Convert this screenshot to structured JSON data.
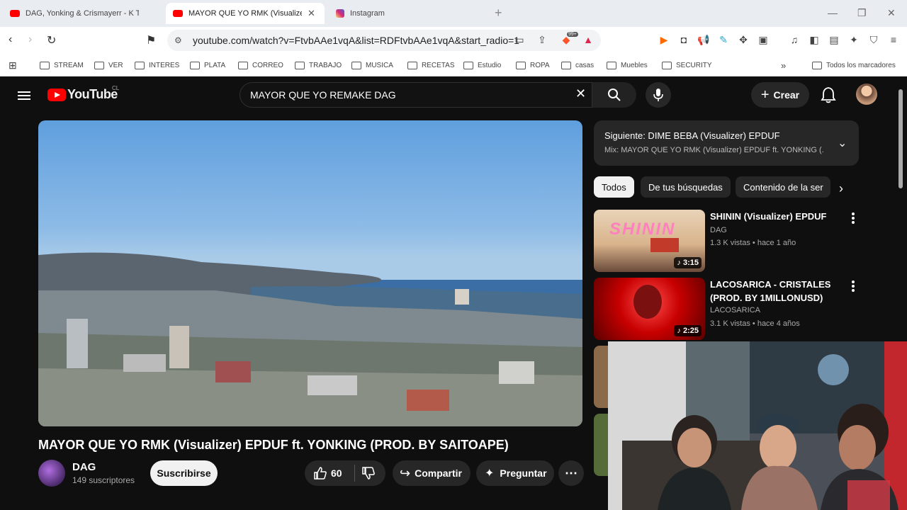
{
  "browser": {
    "tabs": [
      {
        "label": "DAG, Yonking & Crismayerr - K TE VAYA",
        "color": "#ff0000"
      },
      {
        "label": "MAYOR QUE YO RMK (Visualizer) EPDUF",
        "color": "#ff0000"
      },
      {
        "label": "Instagram",
        "color": "#d62976"
      }
    ],
    "url": "youtube.com/watch?v=FtvbAAe1vqA&list=RDFtvbAAe1vqA&start_radio=1",
    "bookmarks": [
      "STREAM",
      "VER",
      "INTERES",
      "PLATA",
      "CORREO",
      "TRABAJO",
      "MUSICA",
      "RECETAS",
      "Estudio",
      "ROPA",
      "casas",
      "Muebles",
      "SECURITY"
    ],
    "all_bookmarks": "Todos los marcadores",
    "brave_badge": "99+"
  },
  "youtube": {
    "logo": "YouTube",
    "region": "CL",
    "search_query": "MAYOR QUE YO REMAKE DAG",
    "create_label": "Crear",
    "video": {
      "title": "MAYOR QUE YO RMK (Visualizer) EPDUF ft. YONKING (PROD. BY SAITOAPE)",
      "channel": "DAG",
      "subscribers": "149 suscriptores",
      "subscribe_label": "Suscribirse",
      "likes": "60",
      "share_label": "Compartir",
      "ask_label": "Preguntar"
    },
    "up_next": {
      "heading": "Siguiente: DIME BEBA (Visualizer) EPDUF",
      "subtitle": "Mix: MAYOR QUE YO RMK (Visualizer) EPDUF ft. YONKING (..."
    },
    "chips": [
      "Todos",
      "De tus búsquedas",
      "Contenido de la ser"
    ],
    "recommendations": [
      {
        "title": "SHININ (Visualizer) EPDUF",
        "channel": "DAG",
        "meta": "1.3 K vistas • hace 1 año",
        "duration": "3:15",
        "thumb_text": "SHININ"
      },
      {
        "title": "LACOSARICA - CRISTALES (PROD. BY 1MILLONUSD)",
        "channel": "LACOSARICA",
        "meta": "3.1 K vistas • hace 4 años",
        "duration": "2:25"
      }
    ]
  }
}
